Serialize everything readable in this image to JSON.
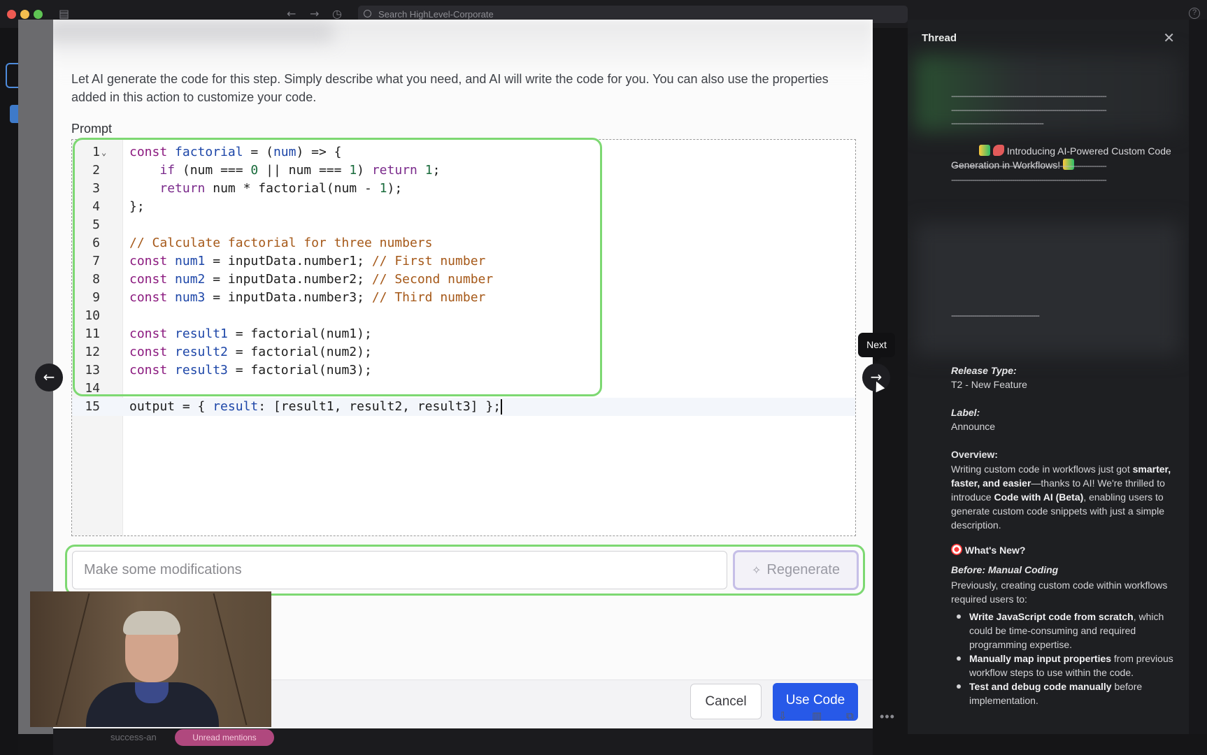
{
  "browser": {
    "search_placeholder": "Search HighLevel-Corporate",
    "help_icon": "?"
  },
  "modal": {
    "description": "Let AI generate the code for this step. Simply describe what you need, and AI will write the code for you. You can also use the properties added in this action to customize your code.",
    "prompt_label": "Prompt",
    "code_lines": [
      "const factorial = (num) => {",
      "    if (num === 0 || num === 1) return 1;",
      "    return num * factorial(num - 1);",
      "};",
      "",
      "// Calculate factorial for three numbers",
      "const num1 = inputData.number1; // First number",
      "const num2 = inputData.number2; // Second number",
      "const num3 = inputData.number3; // Third number",
      "",
      "const result1 = factorial(num1);",
      "const result2 = factorial(num2);",
      "const result3 = factorial(num3);",
      "",
      "output = { result: [result1, result2, result3] };"
    ],
    "line_numbers": [
      "1",
      "2",
      "3",
      "4",
      "5",
      "6",
      "7",
      "8",
      "9",
      "10",
      "11",
      "12",
      "13",
      "14",
      "15"
    ],
    "modifications_placeholder": "Make some modifications",
    "regenerate_label": "Regenerate",
    "cancel_label": "Cancel",
    "use_code_label": "Use Code"
  },
  "navigation": {
    "tooltip": "Next",
    "prev_icon": "arrow-left-icon",
    "next_icon": "arrow-right-icon"
  },
  "slack_footer": {
    "channel_text": "success-an",
    "unread_badge": "Unread mentions"
  },
  "thread": {
    "title": "Thread",
    "intro": "Introducing AI-Powered Custom Code Generation in Workflows!",
    "release_type_label": "Release Type:",
    "release_type_value": "T2 - New Feature",
    "label_label": "Label:",
    "label_value": "Announce",
    "overview_label": "Overview:",
    "overview_1": "Writing custom code in workflows just got ",
    "overview_bold1": "smarter, faster, and easier",
    "overview_2": "—thanks to AI! We're thrilled to introduce ",
    "overview_bold2": "Code with AI (Beta)",
    "overview_3": ", enabling users to generate custom code snippets with just a simple description.",
    "whats_new": "What's New?",
    "before_label": "Before: Manual Coding",
    "before_text": "Previously, creating custom code within workflows required users to:",
    "bullets": [
      {
        "bold": "Write JavaScript code from scratch",
        "rest": ", which could be time-consuming and required programming expertise."
      },
      {
        "bold": "Manually map input properties",
        "rest": " from previous workflow steps to use within the code."
      },
      {
        "bold": "Test and debug code manually",
        "rest": " before implementation."
      }
    ]
  },
  "colors": {
    "highlight_green": "#7dd872",
    "primary_blue": "#2759e8",
    "thread_bg": "#1e1f22"
  }
}
